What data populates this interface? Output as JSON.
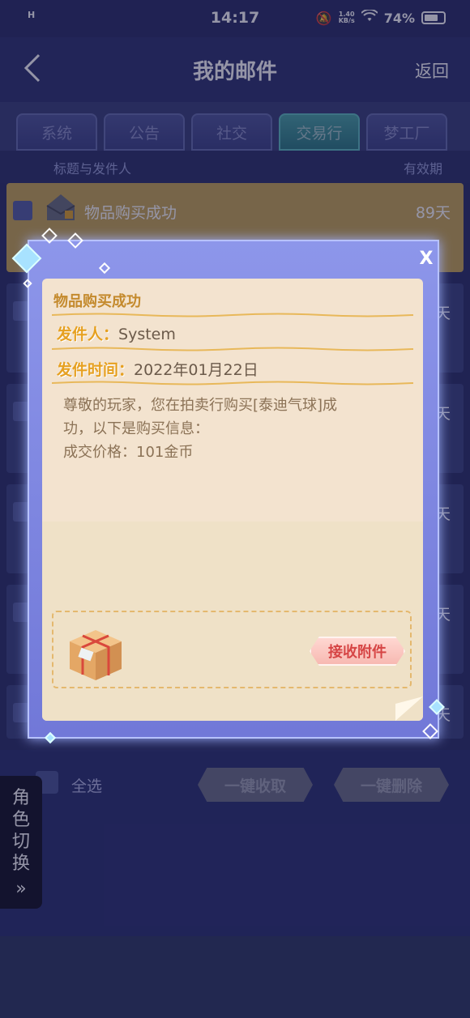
{
  "status_bar": {
    "network_label": "H",
    "time": "14:17",
    "speed_value": "1.40",
    "speed_unit": "KB/s",
    "battery_percent": "74%",
    "battery_level": 0.74
  },
  "header": {
    "title": "我的邮件",
    "return_label": "返回"
  },
  "tabs": [
    {
      "label": "系统",
      "active": false
    },
    {
      "label": "公告",
      "active": false
    },
    {
      "label": "社交",
      "active": false
    },
    {
      "label": "交易行",
      "active": true
    },
    {
      "label": "梦工厂",
      "active": false
    }
  ],
  "columns": {
    "title_sender": "标题与发件人",
    "validity": "有效期"
  },
  "mail_list": [
    {
      "title": "物品购买成功",
      "days": "89天"
    },
    {
      "title": "",
      "days": "天"
    },
    {
      "title": "",
      "days": "天"
    },
    {
      "title": "",
      "days": "天"
    },
    {
      "title": "",
      "days": "天"
    },
    {
      "title": "",
      "days": "天"
    }
  ],
  "bottom": {
    "select_all": "全选",
    "collect_all": "一键收取",
    "delete_all": "一键删除"
  },
  "role_switch": {
    "label": "角色切换",
    "arrows": "»"
  },
  "modal": {
    "title": "物品购买成功",
    "sender_label": "发件人：",
    "sender_value": "System",
    "time_label": "发件时间：",
    "time_value": "2022年01月22日",
    "body_line1": "尊敬的玩家，您在拍卖行购买[泰迪气球]成",
    "body_line2": "功，以下是购买信息：",
    "body_line3": "成交价格：101金币",
    "receive_button": "接收附件",
    "close_label": "X"
  },
  "colors": {
    "background": "#2b3163",
    "modal_frame": "#8d96ea",
    "paper": "#f3e3cf",
    "label_gold": "#e6a020",
    "active_tab": "#2c7b80",
    "receive_text": "#d64545"
  }
}
